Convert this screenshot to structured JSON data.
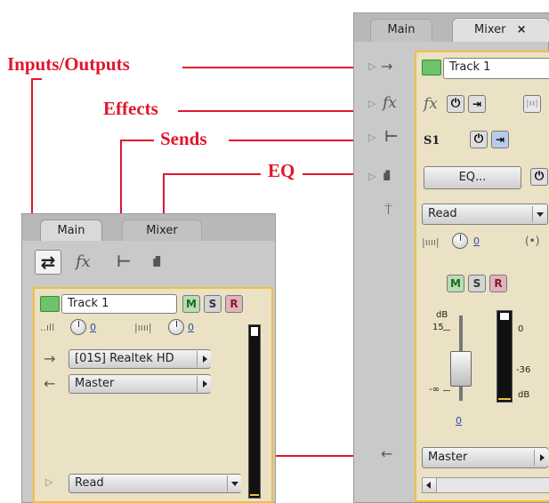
{
  "callouts": {
    "inputs_outputs": "Inputs/Outputs",
    "effects": "Effects",
    "sends": "Sends",
    "eq": "EQ"
  },
  "left_panel": {
    "tabs": [
      "Main",
      "Mixer"
    ],
    "toolbar_icons": [
      "inputs-outputs-icon",
      "fx-icon",
      "sends-icon",
      "eq-icon"
    ],
    "track_name": "Track 1",
    "buttons": {
      "mute": "M",
      "solo": "S",
      "record": "R"
    },
    "knob_value_1": "0",
    "knob_value_2": "0",
    "input_device": "[01S] Realtek HD",
    "output": "Master",
    "automation": "Read"
  },
  "right_panel": {
    "tabs": [
      "Main",
      "Mixer"
    ],
    "tab_close": "×",
    "track_name": "Track 1",
    "fx_label": "fx",
    "send_label": "S1",
    "eq_button": "EQ...",
    "automation": "Read",
    "knob_value": "0",
    "buttons": {
      "mute": "M",
      "solo": "S",
      "record": "R"
    },
    "fader_scale": {
      "db_label": "dB",
      "top": "15",
      "bottom": "-∞",
      "meter_top": "0",
      "meter_mid": "-36",
      "meter_unit": "dB"
    },
    "fader_value": "0",
    "output": "Master"
  },
  "colors": {
    "callout_red": "#e0162b",
    "highlight_yellow": "#f0c040",
    "track_green": "#6cc36a"
  }
}
